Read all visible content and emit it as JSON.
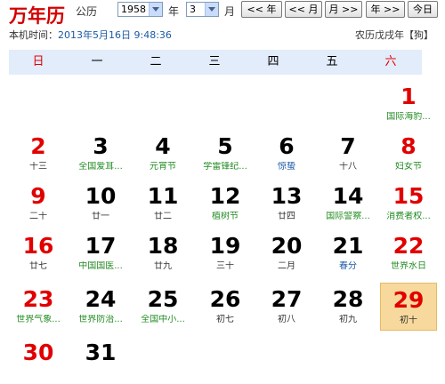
{
  "header": {
    "app_title": "万年历",
    "year_label": "公历",
    "year_value": "1958",
    "year_unit": "年",
    "month_value": "3",
    "month_unit": "月",
    "buttons": [
      "<< 年",
      "<< 月",
      "月 >>",
      "年 >>",
      "今日"
    ]
  },
  "info": {
    "local_time_label": "本机时间：",
    "local_time_value": "2013年5月16日 9:48:36",
    "lunar_year": "农历戊戌年【狗】"
  },
  "weekdays": [
    "日",
    "一",
    "二",
    "三",
    "四",
    "五",
    "六"
  ],
  "days": [
    {
      "d": "1",
      "sub": "国际海豹...",
      "dc": "red",
      "sc": "green"
    },
    {
      "d": "2",
      "sub": "十三",
      "dc": "red",
      "sc": "gray"
    },
    {
      "d": "3",
      "sub": "全国爱耳...",
      "dc": "black",
      "sc": "green"
    },
    {
      "d": "4",
      "sub": "元宵节",
      "dc": "black",
      "sc": "green"
    },
    {
      "d": "5",
      "sub": "学雷锋纪...",
      "dc": "black",
      "sc": "green"
    },
    {
      "d": "6",
      "sub": "惊蛰",
      "dc": "black",
      "sc": "blue"
    },
    {
      "d": "7",
      "sub": "十八",
      "dc": "black",
      "sc": "gray"
    },
    {
      "d": "8",
      "sub": "妇女节",
      "dc": "red",
      "sc": "green"
    },
    {
      "d": "9",
      "sub": "二十",
      "dc": "red",
      "sc": "gray"
    },
    {
      "d": "10",
      "sub": "廿一",
      "dc": "black",
      "sc": "gray"
    },
    {
      "d": "11",
      "sub": "廿二",
      "dc": "black",
      "sc": "gray"
    },
    {
      "d": "12",
      "sub": "植树节",
      "dc": "black",
      "sc": "green"
    },
    {
      "d": "13",
      "sub": "廿四",
      "dc": "black",
      "sc": "gray"
    },
    {
      "d": "14",
      "sub": "国际警察...",
      "dc": "black",
      "sc": "green"
    },
    {
      "d": "15",
      "sub": "消费者权...",
      "dc": "red",
      "sc": "green"
    },
    {
      "d": "16",
      "sub": "廿七",
      "dc": "red",
      "sc": "gray"
    },
    {
      "d": "17",
      "sub": "中国国医...",
      "dc": "black",
      "sc": "green"
    },
    {
      "d": "18",
      "sub": "廿九",
      "dc": "black",
      "sc": "gray"
    },
    {
      "d": "19",
      "sub": "三十",
      "dc": "black",
      "sc": "gray"
    },
    {
      "d": "20",
      "sub": "二月",
      "dc": "black",
      "sc": "gray"
    },
    {
      "d": "21",
      "sub": "春分",
      "dc": "black",
      "sc": "blue"
    },
    {
      "d": "22",
      "sub": "世界水日",
      "dc": "red",
      "sc": "green"
    },
    {
      "d": "23",
      "sub": "世界气象...",
      "dc": "red",
      "sc": "green"
    },
    {
      "d": "24",
      "sub": "世界防治...",
      "dc": "black",
      "sc": "green"
    },
    {
      "d": "25",
      "sub": "全国中小...",
      "dc": "black",
      "sc": "green"
    },
    {
      "d": "26",
      "sub": "初七",
      "dc": "black",
      "sc": "gray"
    },
    {
      "d": "27",
      "sub": "初八",
      "dc": "black",
      "sc": "gray"
    },
    {
      "d": "28",
      "sub": "初九",
      "dc": "black",
      "sc": "gray"
    },
    {
      "d": "29",
      "sub": "初十",
      "dc": "red",
      "sc": "gray",
      "today": true
    },
    {
      "d": "30",
      "sub": "",
      "dc": "red",
      "sc": "gray"
    },
    {
      "d": "31",
      "sub": "",
      "dc": "black",
      "sc": "gray"
    }
  ],
  "colors": {
    "accent_red": "#e10000",
    "header_band": "#e2ecfa",
    "today_bg": "#f8d99d",
    "festival_green": "#228b22",
    "term_blue": "#1c58a8"
  }
}
